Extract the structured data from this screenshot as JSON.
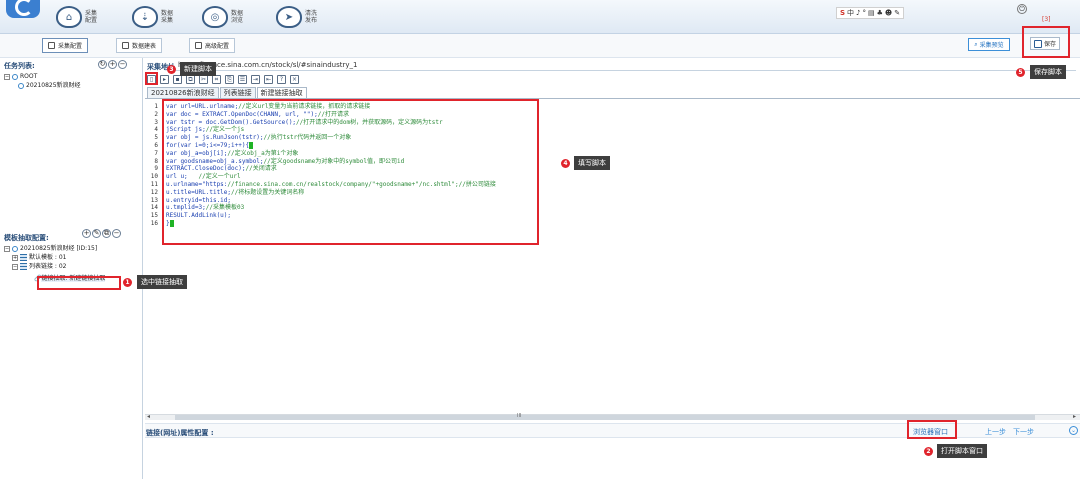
{
  "topbar": {
    "nav": [
      {
        "icon": "home-icon",
        "l1": "采集",
        "l2": "配置"
      },
      {
        "icon": "download-icon",
        "l1": "数据",
        "l2": "采集"
      },
      {
        "icon": "browse-icon",
        "l1": "数据",
        "l2": "浏览"
      },
      {
        "icon": "publish-icon",
        "l1": "清洗",
        "l2": "发布"
      }
    ],
    "tray_icons": [
      "S",
      "中",
      "♪",
      "°",
      "▤",
      "♣",
      "☻",
      "✎"
    ],
    "count_label": "[3]"
  },
  "subbar": {
    "tabs": [
      "采集配置",
      "数据建表",
      "高级配置"
    ],
    "preview_label": "采集预览",
    "save_label": "保存"
  },
  "left": {
    "task_header": "任务列表:",
    "tree_root": "ROOT",
    "tree_child": "20210825新浪财经",
    "template_header": "模板抽取配置:",
    "tpl_root": "20210825新浪财经 [ID:15]",
    "tpl_item1": "默认模板 : 01",
    "tpl_item2": "列表链接 : 02",
    "tpl_selected": "链接抽取: 新建链接抽取"
  },
  "main": {
    "url_label": "采集地址",
    "url": "http://finance.sina.com.cn/stock/sl/#sinaindustry_1",
    "tabs": [
      "20210826新浪财经",
      "列表链接",
      "新建链接抽取"
    ],
    "code_lines": [
      "var url=URL.urlname;//定义url变量为当前请求链接，抓取的请求链接",
      "var doc = EXTRACT.OpenDoc(CHANN, url, \"\");//打开请求",
      "var tstr = doc.GetDom().GetSource();//打开请求中的dom树，并获取源码，定义源码为tstr",
      "jScript js;//定义一个js",
      "var obj = js.RunJson(tstr);//执行tstr代码并返回一个对象",
      "for(var i=0;i<=79;i++){",
      "var obj_a=obj[i];//定义obj_a为第i个对象",
      "var goodsname=obj_a.symbol;//定义goodsname为对象中的symbol值，即公司id",
      "EXTRACT.CloseDoc(doc);//关闭请求",
      "url u;   //定义一个url",
      "u.urlname=\"https://finance.sina.com.cn/realstock/company/\"+goodsname+\"/nc.shtml\";//拼公司链接",
      "u.title=URL.title;//将标题设置为关键词名称",
      "u.entryid=this.id;",
      "u.tmplid=3;//采集模板03",
      "RESULT.AddLink(u);",
      "}"
    ],
    "scroll_marker": "III",
    "link_attr_header": "链接(网址)属性配置 :",
    "browser_btn": "浏览器窗口",
    "prev": "上一步",
    "next": "下一步"
  },
  "annotations": [
    {
      "num": "1",
      "text": "选中链接抽取"
    },
    {
      "num": "2",
      "text": "打开脚本窗口"
    },
    {
      "num": "3",
      "text": "新建脚本"
    },
    {
      "num": "4",
      "text": "填写脚本"
    },
    {
      "num": "5",
      "text": "保存脚本"
    }
  ]
}
